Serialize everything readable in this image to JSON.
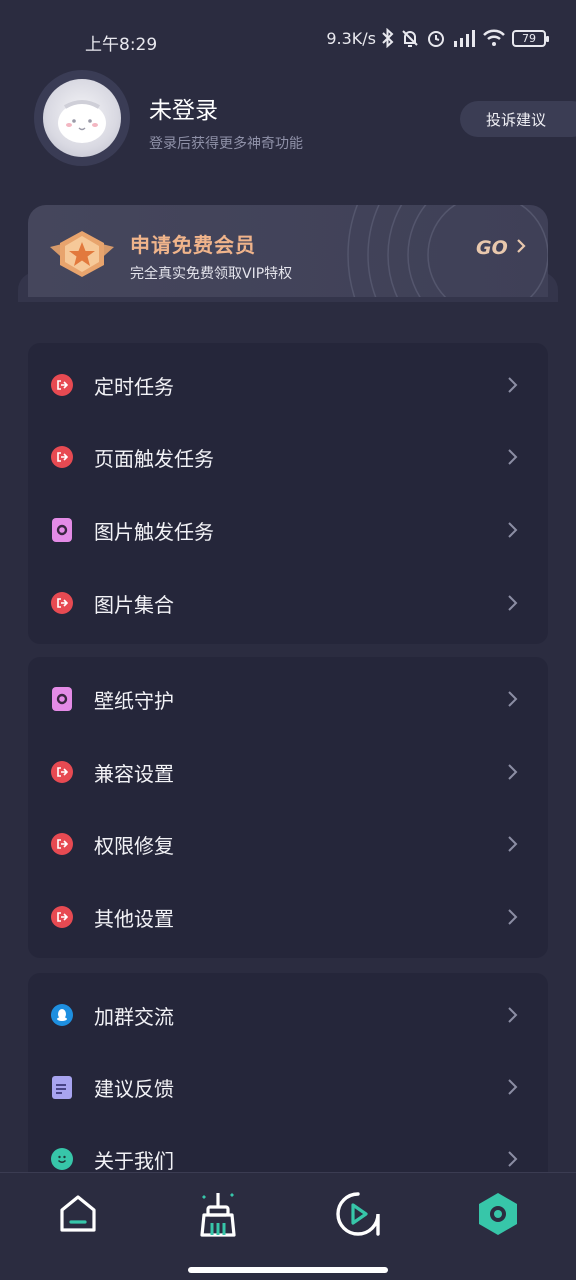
{
  "status_bar": {
    "time": "上午8:29",
    "net_speed": "9.3K/s",
    "battery": "79"
  },
  "profile": {
    "name": "未登录",
    "subtitle": "登录后获得更多神奇功能",
    "feedback_button": "投诉建议"
  },
  "vip_banner": {
    "title": "申请免费会员",
    "subtitle": "完全真实免费领取VIP特权",
    "go_label": "GO"
  },
  "menu_groups": [
    {
      "items": [
        {
          "label": "定时任务",
          "icon": "red-exit-icon"
        },
        {
          "label": "页面触发任务",
          "icon": "red-exit-icon"
        },
        {
          "label": "图片触发任务",
          "icon": "pink-image-icon"
        },
        {
          "label": "图片集合",
          "icon": "red-exit-icon"
        }
      ]
    },
    {
      "items": [
        {
          "label": "壁纸守护",
          "icon": "pink-image-icon"
        },
        {
          "label": "兼容设置",
          "icon": "red-exit-icon"
        },
        {
          "label": "权限修复",
          "icon": "red-exit-icon"
        },
        {
          "label": "其他设置",
          "icon": "red-exit-icon"
        }
      ]
    },
    {
      "items": [
        {
          "label": "加群交流",
          "icon": "qq-icon"
        },
        {
          "label": "建议反馈",
          "icon": "feedback-doc-icon"
        },
        {
          "label": "关于我们",
          "icon": "smile-icon"
        }
      ]
    }
  ],
  "bottom_nav": [
    "home-icon",
    "clean-brush-icon",
    "play-icon",
    "settings-hex-icon"
  ],
  "colors": {
    "background": "#2b2c40",
    "card": "#25263a",
    "accent_red": "#e74a52",
    "accent_pink": "#e48be6",
    "accent_teal": "#37c6a9",
    "vip_gold": "#f0b48b"
  }
}
